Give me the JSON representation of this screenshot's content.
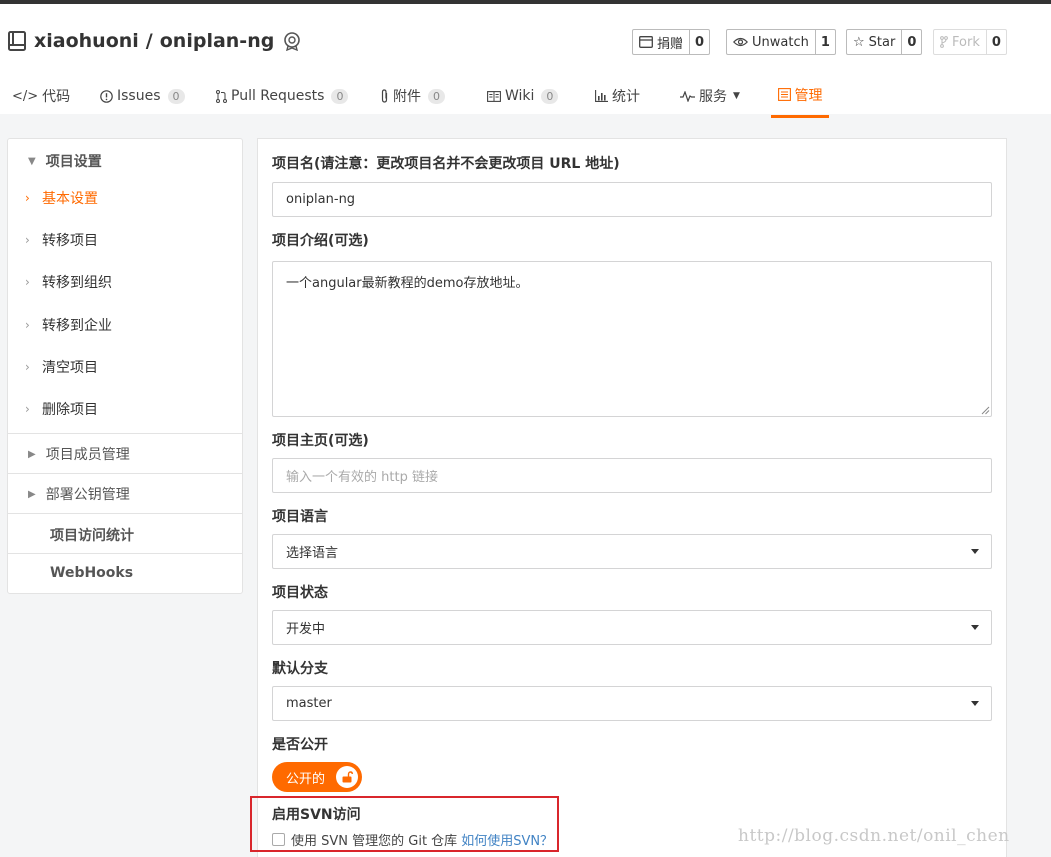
{
  "repo": {
    "owner": "xiaohuoni",
    "separator": "/",
    "name": "oniplan-ng"
  },
  "actions": [
    {
      "label": "捐赠",
      "count": "0"
    },
    {
      "label": "Unwatch",
      "count": "1"
    },
    {
      "label": "Star",
      "count": "0"
    },
    {
      "label": "Fork",
      "count": "0"
    }
  ],
  "tabs": [
    {
      "label": "代码"
    },
    {
      "label": "Issues",
      "count": "0"
    },
    {
      "label": "Pull Requests",
      "count": "0"
    },
    {
      "label": "附件",
      "count": "0"
    },
    {
      "label": "Wiki",
      "count": "0"
    },
    {
      "label": "统计"
    },
    {
      "label": "服务"
    },
    {
      "label": "管理"
    }
  ],
  "sidebar": {
    "settings_header": "项目设置",
    "items": [
      "基本设置",
      "转移项目",
      "转移到组织",
      "转移到企业",
      "清空项目",
      "删除项目"
    ],
    "member_header": "项目成员管理",
    "deploy_header": "部署公钥管理",
    "stats": "项目访问统计",
    "webhooks": "WebHooks"
  },
  "form": {
    "name_label": "项目名(请注意：更改项目名并不会更改项目 URL 地址)",
    "name_value": "oniplan-ng",
    "desc_label": "项目介绍(可选)",
    "desc_value": "一个angular最新教程的demo存放地址。",
    "homepage_label": "项目主页(可选)",
    "homepage_placeholder": "输入一个有效的 http 链接",
    "lang_label": "项目语言",
    "lang_value": "选择语言",
    "status_label": "项目状态",
    "status_value": "开发中",
    "branch_label": "默认分支",
    "branch_value": "master",
    "public_label": "是否公开",
    "public_value": "公开的",
    "svn_label": "启用SVN访问",
    "svn_text": "使用 SVN 管理您的 Git 仓库",
    "svn_link": "如何使用SVN？"
  },
  "watermark": "http://blog.csdn.net/onil_chen",
  "colors": {
    "accent": "#ff6a00",
    "highlight_box": "#d9262c",
    "link": "#4183c4"
  }
}
